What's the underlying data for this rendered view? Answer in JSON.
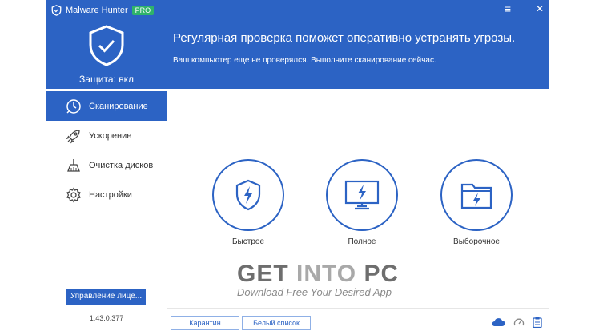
{
  "window": {
    "app_title": "Malware Hunter",
    "edition_badge": "PRO",
    "minimize_glyph": "–",
    "menu_glyph": "≡",
    "close_glyph": "✕"
  },
  "header": {
    "protection_status": "Защита: вкл",
    "headline": "Регулярная проверка поможет оперативно устранять угрозы.",
    "subline": "Ваш компьютер еще не проверялся. Выполните сканирование сейчас."
  },
  "sidebar": {
    "items": [
      {
        "label": "Сканирование",
        "icon": "scan-icon",
        "active": true
      },
      {
        "label": "Ускорение",
        "icon": "rocket-icon",
        "active": false
      },
      {
        "label": "Очистка дисков",
        "icon": "broom-icon",
        "active": false
      },
      {
        "label": "Настройки",
        "icon": "gear-icon",
        "active": false
      }
    ],
    "license_button": "Управление лице...",
    "version": "1.43.0.377"
  },
  "scan_options": [
    {
      "label": "Быстрое",
      "icon": "shield-lightning-icon"
    },
    {
      "label": "Полное",
      "icon": "monitor-lightning-icon"
    },
    {
      "label": "Выборочное",
      "icon": "folder-lightning-icon"
    }
  ],
  "footer": {
    "quarantine_button": "Карантин",
    "whitelist_button": "Белый список",
    "icons": [
      "cloud-icon",
      "speedometer-icon",
      "clipboard-icon"
    ]
  },
  "watermark": {
    "get": "GET ",
    "into": "INTO",
    "pc": " PC",
    "tagline": "Download Free Your Desired App"
  },
  "colors": {
    "accent": "#2c63c4",
    "badge": "#2fb36a"
  }
}
